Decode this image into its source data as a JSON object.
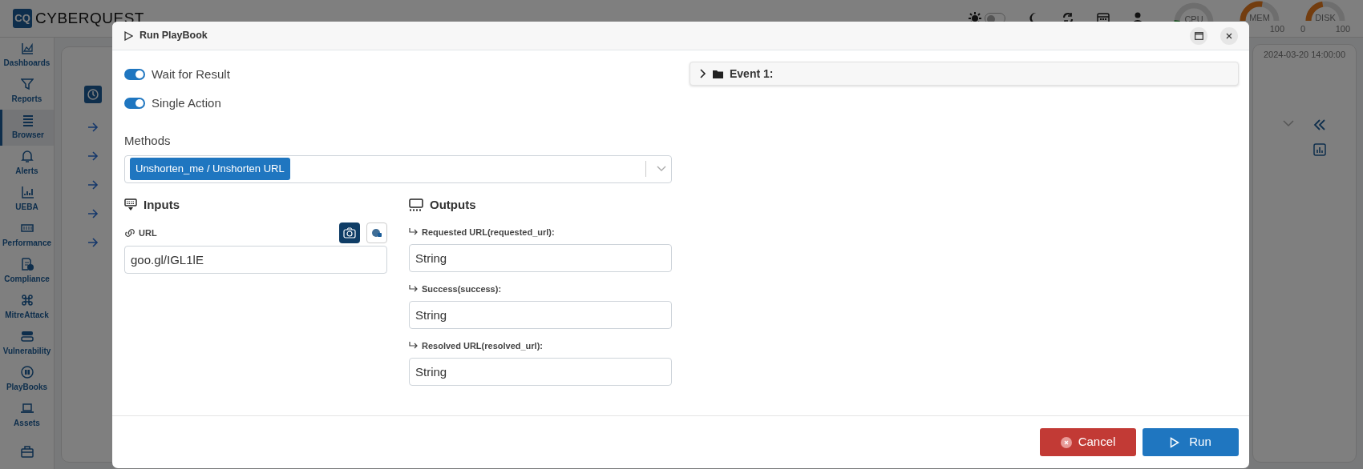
{
  "app": {
    "logo_mark": "CQ",
    "logo_text": "CYBERQUEST"
  },
  "topbar": {
    "dark_mode": false,
    "gauges": [
      {
        "label": "CPU",
        "level": 0.04
      },
      {
        "label": "MEM",
        "level": 0.55,
        "scale": [
          "100"
        ]
      },
      {
        "label": "DISK",
        "level": 0.45,
        "scale": [
          "0",
          "100"
        ]
      }
    ],
    "timeline_label": "2024-03-20 14:00:00"
  },
  "sidebar": {
    "items": [
      {
        "label": "Dashboards",
        "selected": false
      },
      {
        "label": "Reports",
        "selected": false
      },
      {
        "label": "Browser",
        "selected": true
      },
      {
        "label": "Alerts",
        "selected": false
      },
      {
        "label": "UEBA",
        "selected": false
      },
      {
        "label": "Performance",
        "selected": false
      },
      {
        "label": "Compliance",
        "selected": false
      },
      {
        "label": "MitreAttack",
        "selected": false
      },
      {
        "label": "Vulnerability",
        "selected": false
      },
      {
        "label": "PlayBooks",
        "selected": false
      },
      {
        "label": "Assets",
        "selected": false
      },
      {
        "selected": false
      }
    ]
  },
  "modal": {
    "title": "Run PlayBook",
    "toggles": [
      {
        "label": "Wait for Result",
        "on": true
      },
      {
        "label": "Single Action",
        "on": true
      }
    ],
    "methods": {
      "label": "Methods",
      "tags": [
        "Unshorten_me / Unshorten URL"
      ]
    },
    "inputs": {
      "title": "Inputs",
      "fields": [
        {
          "label": "URL",
          "value": "goo.gl/IGL1lE"
        }
      ]
    },
    "outputs": {
      "title": "Outputs",
      "fields": [
        {
          "label": "Requested URL(requested_url):",
          "value": "String"
        },
        {
          "label": "Success(success):",
          "value": "String"
        },
        {
          "label": "Resolved URL(resolved_url):",
          "value": "String"
        }
      ]
    },
    "events": [
      {
        "label": "Event 1:",
        "expanded": false
      }
    ],
    "buttons": [
      {
        "label": "Cancel",
        "kind": "cancel"
      },
      {
        "label": "Run",
        "kind": "run"
      }
    ]
  }
}
